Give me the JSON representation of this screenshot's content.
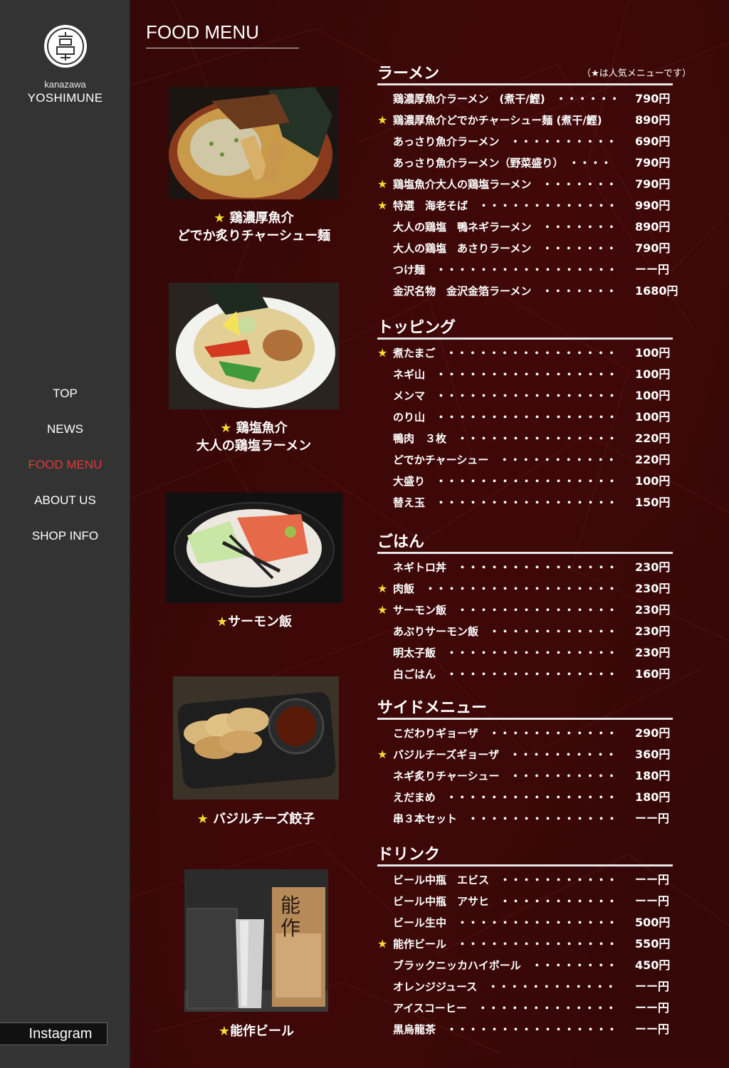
{
  "sidebar": {
    "logo_icon": "yoshimune-crest-icon",
    "brand_small": "kanazawa",
    "brand_big": "YOSHIMUNE",
    "nav": [
      "TOP",
      "NEWS",
      "FOOD MENU",
      "ABOUT US",
      "SHOP INFO"
    ],
    "active_nav": "FOOD MENU",
    "instagram": "Instagram"
  },
  "colors": {
    "accent_red": "#e03a3a",
    "star_yellow": "#f5dd32",
    "bg": "#350707",
    "sidebar": "#333333"
  },
  "page_title": "FOOD MENU",
  "photos": [
    {
      "star": "★",
      "caption1": "鶏濃厚魚介",
      "caption2": "どでか炙りチャーシュー麺"
    },
    {
      "star": "★",
      "caption1": "鶏塩魚介",
      "caption2": "大人の鶏塩ラーメン"
    },
    {
      "star": "★",
      "caption1": "サーモン飯",
      "caption2": ""
    },
    {
      "star": "★",
      "caption1": "バジルチーズ餃子",
      "caption2": ""
    },
    {
      "star": "★",
      "caption1": "能作ビール",
      "caption2": ""
    }
  ],
  "menu": {
    "note": "（★は人気メニューです）",
    "sections": [
      {
        "title": "ラーメン",
        "items": [
          {
            "star": "",
            "name": "鶏濃厚魚介ラーメン　(煮干/鰹)　・・・・・・",
            "price": "790円"
          },
          {
            "star": "★",
            "name": "鶏濃厚魚介どでかチャーシュー麺 (煮干/鰹)",
            "price": "890円"
          },
          {
            "star": "",
            "name": "あっさり魚介ラーメン　・・・・・・・・・・",
            "price": "690円"
          },
          {
            "star": "",
            "name": "あっさり魚介ラーメン（野菜盛り）　・・・・",
            "price": "790円"
          },
          {
            "star": "★",
            "name": "鶏塩魚介大人の鶏塩ラーメン　・・・・・・・",
            "price": "790円"
          },
          {
            "star": "★",
            "name": "特選　海老そば　・・・・・・・・・・・・・",
            "price": "990円"
          },
          {
            "star": "",
            "name": "大人の鶏塩　鴨ネギラーメン　・・・・・・・",
            "price": "890円"
          },
          {
            "star": "",
            "name": "大人の鶏塩　あさりラーメン　・・・・・・・",
            "price": "790円"
          },
          {
            "star": "",
            "name": "つけ麺　・・・・・・・・・・・・・・・・・",
            "price": "ーー円"
          },
          {
            "star": "",
            "name": "金沢名物　金沢金箔ラーメン　・・・・・・・",
            "price": "1680円"
          }
        ]
      },
      {
        "title": "トッピング",
        "items": [
          {
            "star": "★",
            "name": "煮たまご　・・・・・・・・・・・・・・・・",
            "price": "100円"
          },
          {
            "star": "",
            "name": "ネギ山　・・・・・・・・・・・・・・・・・",
            "price": "100円"
          },
          {
            "star": "",
            "name": "メンマ　・・・・・・・・・・・・・・・・・",
            "price": "100円"
          },
          {
            "star": "",
            "name": "のり山　・・・・・・・・・・・・・・・・・",
            "price": "100円"
          },
          {
            "star": "",
            "name": "鴨肉　３枚　・・・・・・・・・・・・・・・",
            "price": "220円"
          },
          {
            "star": "",
            "name": "どでかチャーシュー　・・・・・・・・・・・",
            "price": "220円"
          },
          {
            "star": "",
            "name": "大盛り　・・・・・・・・・・・・・・・・・",
            "price": "100円"
          },
          {
            "star": "",
            "name": "替え玉　・・・・・・・・・・・・・・・・・",
            "price": "150円"
          }
        ]
      },
      {
        "title": "ごはん",
        "items": [
          {
            "star": "",
            "name": "ネギトロ丼　・・・・・・・・・・・・・・・",
            "price": "230円"
          },
          {
            "star": "★",
            "name": "肉飯　・・・・・・・・・・・・・・・・・・",
            "price": "230円"
          },
          {
            "star": "★",
            "name": "サーモン飯　・・・・・・・・・・・・・・・",
            "price": "230円"
          },
          {
            "star": "",
            "name": "あぶりサーモン飯　・・・・・・・・・・・・",
            "price": "230円"
          },
          {
            "star": "",
            "name": "明太子飯　・・・・・・・・・・・・・・・・",
            "price": "230円"
          },
          {
            "star": "",
            "name": "白ごはん　・・・・・・・・・・・・・・・・",
            "price": "160円"
          }
        ]
      },
      {
        "title": "サイドメニュー",
        "items": [
          {
            "star": "",
            "name": "こだわりギョーザ　・・・・・・・・・・・・",
            "price": "290円"
          },
          {
            "star": "★",
            "name": "バジルチーズギョーザ　・・・・・・・・・・",
            "price": "360円"
          },
          {
            "star": "",
            "name": "ネギ炙りチャーシュー　・・・・・・・・・・",
            "price": "180円"
          },
          {
            "star": "",
            "name": "えだまめ　・・・・・・・・・・・・・・・・",
            "price": "180円"
          },
          {
            "star": "",
            "name": "串３本セット　・・・・・・・・・・・・・・",
            "price": "ーー円"
          }
        ]
      },
      {
        "title": "ドリンク",
        "items": [
          {
            "star": "",
            "name": "ビール中瓶　エビス　・・・・・・・・・・・",
            "price": "ーー円"
          },
          {
            "star": "",
            "name": "ビール中瓶　アサヒ　・・・・・・・・・・・",
            "price": "ーー円"
          },
          {
            "star": "",
            "name": "ビール生中　・・・・・・・・・・・・・・・",
            "price": "500円"
          },
          {
            "star": "★",
            "name": "能作ビール　・・・・・・・・・・・・・・・",
            "price": "550円"
          },
          {
            "star": "",
            "name": "ブラックニッカハイボール　・・・・・・・・",
            "price": "450円"
          },
          {
            "star": "",
            "name": "オレンジジュース　・・・・・・・・・・・・",
            "price": "ーー円"
          },
          {
            "star": "",
            "name": "アイスコーヒー　・・・・・・・・・・・・・",
            "price": "ーー円"
          },
          {
            "star": "",
            "name": "黒烏龍茶　・・・・・・・・・・・・・・・・",
            "price": "ーー円"
          }
        ]
      }
    ]
  }
}
